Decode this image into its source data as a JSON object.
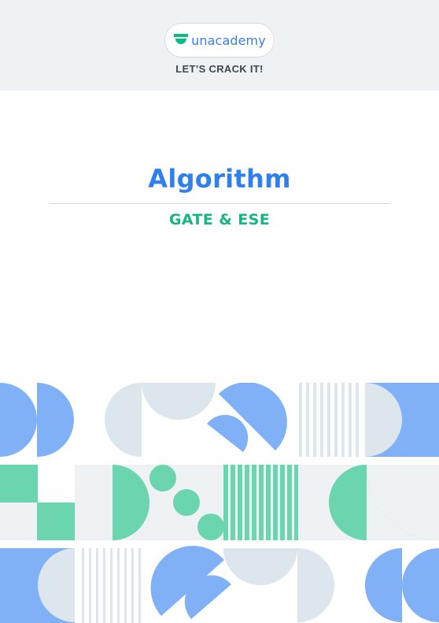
{
  "brand": {
    "name": "unacademy",
    "tagline": "LET’S CRACK IT!",
    "logo_icon": "unacademy-logo-icon",
    "color": "#3b7fe0",
    "icon_color": "#08bd80"
  },
  "cover": {
    "title": "Algorithm",
    "subtitle": "GATE & ESE",
    "title_color": "#2f80ed",
    "subtitle_color": "#16b683"
  },
  "pattern_colors": {
    "blue": "#80b1f6",
    "green": "#6ad5ae",
    "grey": "#dde5ed",
    "light": "#eff2f4"
  }
}
